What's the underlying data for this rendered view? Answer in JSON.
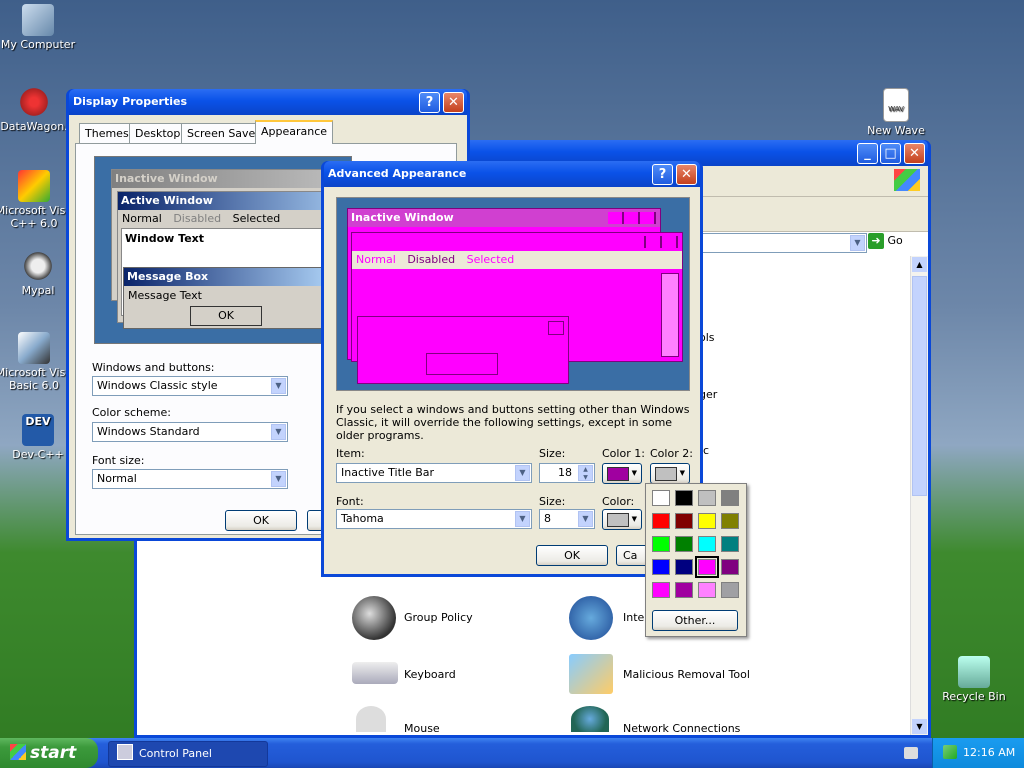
{
  "desktop_icons": [
    {
      "label": "My Computer"
    },
    {
      "label": "DataWagon."
    },
    {
      "label": "Microsoft Visu C++ 6.0"
    },
    {
      "label": "Mypal"
    },
    {
      "label": "Microsoft Visu Basic 6.0"
    },
    {
      "label": "Dev-C++"
    },
    {
      "label": "New Wave"
    },
    {
      "label": "Recycle Bin"
    }
  ],
  "display_properties": {
    "title": "Display Properties",
    "tabs": [
      "Themes",
      "Desktop",
      "Screen Saver",
      "Appearance"
    ],
    "preview": {
      "inactive": "Inactive Window",
      "active": "Active Window",
      "menu": [
        "Normal",
        "Disabled",
        "Selected"
      ],
      "window_text": "Window Text",
      "message_box": "Message Box",
      "message_text": "Message Text",
      "ok": "OK"
    },
    "windows_buttons_label": "Windows and buttons:",
    "windows_buttons_value": "Windows Classic style",
    "color_scheme_label": "Color scheme:",
    "color_scheme_value": "Windows Standard",
    "font_size_label": "Font size:",
    "font_size_value": "Normal",
    "ok": "OK"
  },
  "control_panel": {
    "go": "Go",
    "items": [
      {
        "label": "Group Policy"
      },
      {
        "label": "Inter"
      },
      {
        "label": "Keyboard"
      },
      {
        "label": "Malicious Removal Tool"
      },
      {
        "label": "Mouse"
      },
      {
        "label": "Network Connections"
      },
      {
        "label": "ols"
      },
      {
        "label": "ger"
      },
      {
        "label": "c"
      }
    ]
  },
  "advanced": {
    "title": "Advanced Appearance",
    "preview": {
      "inactive": "Inactive Window",
      "menu": [
        "Normal",
        "Disabled",
        "Selected"
      ]
    },
    "info": "If you select a windows and buttons setting other than Windows Classic, it will override the following settings, except in some older programs.",
    "item_label": "Item:",
    "item_value": "Inactive Title Bar",
    "size_label": "Size:",
    "size_value": "18",
    "color1_label": "Color 1:",
    "color2_label": "Color 2:",
    "font_label": "Font:",
    "font_value": "Tahoma",
    "size2_label": "Size:",
    "size2_value": "8",
    "color_label": "Color:",
    "ok": "OK",
    "cancel": "Ca"
  },
  "palette": {
    "colors": [
      "#ffffff",
      "#000000",
      "#c0c0c0",
      "#808080",
      "#ff0000",
      "#800000",
      "#ffff00",
      "#808000",
      "#00ff00",
      "#008000",
      "#00ffff",
      "#008080",
      "#0000ff",
      "#000080",
      "#ff00ff",
      "#800080",
      "#ff00ff",
      "#a000a0",
      "#ff80ff",
      "#a0a0a4"
    ],
    "other": "Other..."
  },
  "taskbar": {
    "start": "start",
    "task": "Control Panel",
    "clock": "12:16 AM"
  },
  "colors": {
    "accent": "#ff00ff",
    "title_blue": "#0a48d8"
  }
}
